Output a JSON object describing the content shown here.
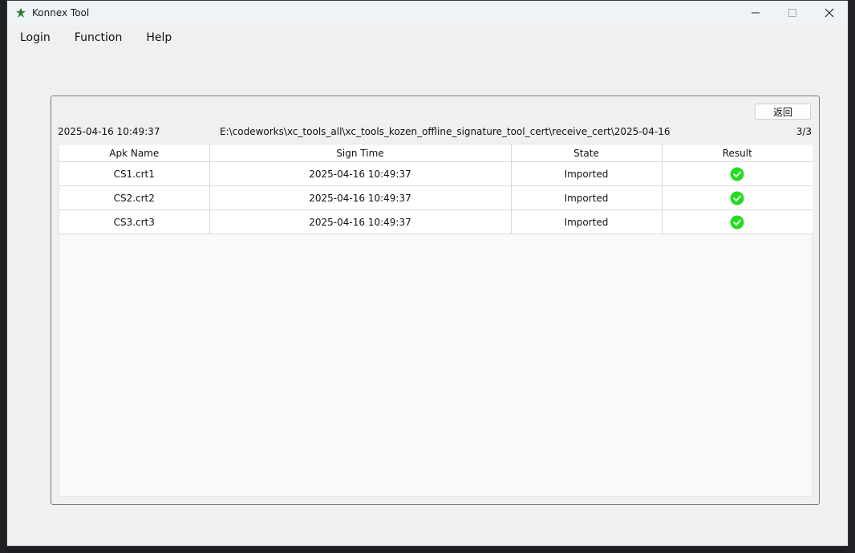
{
  "window": {
    "title": "Konnex Tool",
    "controls": {
      "minimize": "—",
      "maximize": "☐",
      "close": "✕"
    }
  },
  "menu": [
    {
      "label": "Login"
    },
    {
      "label": "Function"
    },
    {
      "label": "Help"
    }
  ],
  "panel": {
    "back_label": "返回",
    "date": "2025-04-16 10:49:37",
    "path": "E:\\codeworks\\xc_tools_all\\xc_tools_kozen_offline_signature_tool_cert\\receive_cert\\2025-04-16",
    "count": "3/3"
  },
  "table": {
    "columns": [
      "Apk Name",
      "Sign Time",
      "State",
      "Result"
    ],
    "rows": [
      {
        "name": "CS1.crt1",
        "time": "2025-04-16 10:49:37",
        "state": "Imported",
        "result": "success-icon"
      },
      {
        "name": "CS2.crt2",
        "time": "2025-04-16 10:49:37",
        "state": "Imported",
        "result": "success-icon"
      },
      {
        "name": "CS3.crt3",
        "time": "2025-04-16 10:49:37",
        "state": "Imported",
        "result": "success-icon"
      }
    ]
  },
  "colors": {
    "success": "#22dd22",
    "accent_icon": "#2e7d32"
  }
}
